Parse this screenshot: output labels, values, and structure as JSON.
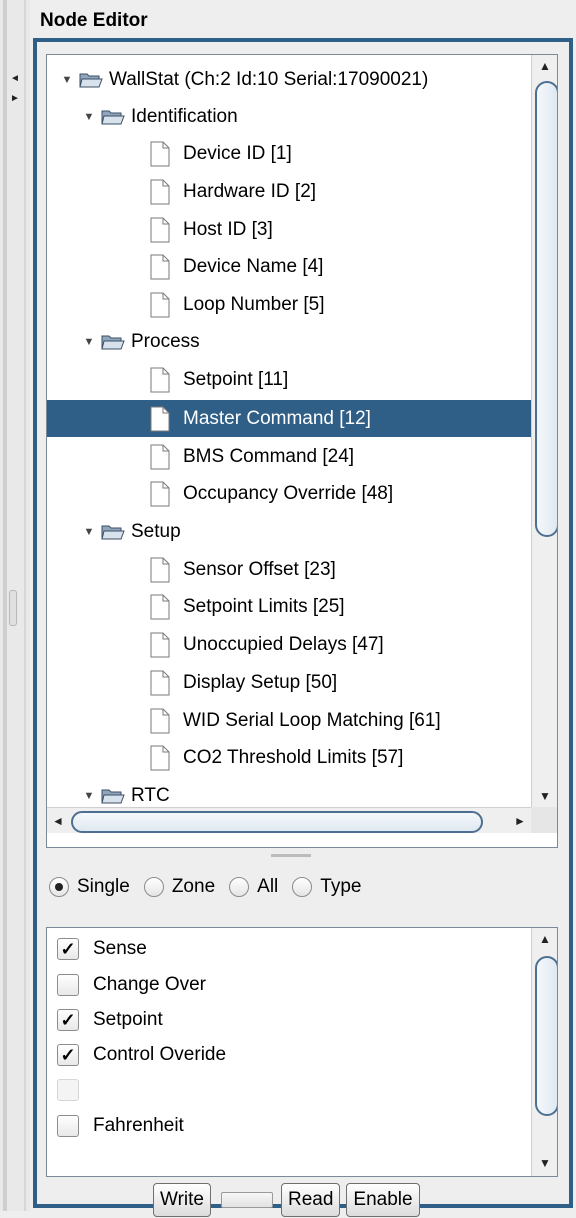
{
  "panel": {
    "title": "Node Editor"
  },
  "tree": {
    "items": [
      {
        "label": "WallStat (Ch:2 Id:10 Serial:17090021)",
        "type": "folder",
        "level": 0,
        "expanded": true,
        "selected": false
      },
      {
        "label": "Identification",
        "type": "folder",
        "level": 1,
        "expanded": true,
        "selected": false
      },
      {
        "label": "Device ID [1]",
        "type": "leaf",
        "level": 2,
        "selected": false
      },
      {
        "label": "Hardware ID [2]",
        "type": "leaf",
        "level": 2,
        "selected": false
      },
      {
        "label": "Host ID [3]",
        "type": "leaf",
        "level": 2,
        "selected": false
      },
      {
        "label": "Device Name [4]",
        "type": "leaf",
        "level": 2,
        "selected": false
      },
      {
        "label": "Loop Number [5]",
        "type": "leaf",
        "level": 2,
        "selected": false
      },
      {
        "label": "Process",
        "type": "folder",
        "level": 1,
        "expanded": true,
        "selected": false
      },
      {
        "label": "Setpoint [11]",
        "type": "leaf",
        "level": 2,
        "selected": false
      },
      {
        "label": "Master Command [12]",
        "type": "leaf",
        "level": 2,
        "selected": true
      },
      {
        "label": "BMS Command [24]",
        "type": "leaf",
        "level": 2,
        "selected": false
      },
      {
        "label": "Occupancy Override [48]",
        "type": "leaf",
        "level": 2,
        "selected": false
      },
      {
        "label": "Setup",
        "type": "folder",
        "level": 1,
        "expanded": true,
        "selected": false
      },
      {
        "label": "Sensor Offset [23]",
        "type": "leaf",
        "level": 2,
        "selected": false
      },
      {
        "label": "Setpoint Limits [25]",
        "type": "leaf",
        "level": 2,
        "selected": false
      },
      {
        "label": "Unoccupied Delays [47]",
        "type": "leaf",
        "level": 2,
        "selected": false
      },
      {
        "label": "Display Setup [50]",
        "type": "leaf",
        "level": 2,
        "selected": false
      },
      {
        "label": "WID Serial Loop Matching [61]",
        "type": "leaf",
        "level": 2,
        "selected": false
      },
      {
        "label": "CO2 Threshold Limits [57]",
        "type": "leaf",
        "level": 2,
        "selected": false
      },
      {
        "label": "RTC",
        "type": "folder",
        "level": 1,
        "expanded": true,
        "selected": false
      }
    ]
  },
  "mode": {
    "options": [
      {
        "label": "Single",
        "selected": true
      },
      {
        "label": "Zone",
        "selected": false
      },
      {
        "label": "All",
        "selected": false
      },
      {
        "label": "Type",
        "selected": false
      }
    ]
  },
  "options_list": [
    {
      "label": "Sense",
      "checked": true,
      "enabled": true
    },
    {
      "label": "Change Over",
      "checked": false,
      "enabled": true
    },
    {
      "label": "Setpoint",
      "checked": true,
      "enabled": true
    },
    {
      "label": "Control Overide",
      "checked": true,
      "enabled": true
    },
    {
      "label": "",
      "checked": false,
      "enabled": false
    },
    {
      "label": "Fahrenheit",
      "checked": false,
      "enabled": true
    }
  ],
  "buttons": {
    "write": "Write",
    "read": "Read",
    "enable": "Enable"
  },
  "progress": {
    "value": 0
  },
  "colors": {
    "accent": "#2f5e86",
    "selection": "#2f5e86"
  },
  "icons": {
    "tree_expanded": "triangle-down-icon",
    "folder": "folder-open-icon",
    "leaf": "document-icon",
    "checkmark": "✓",
    "scroll_up": "▲",
    "scroll_down": "▼",
    "scroll_left": "◄",
    "scroll_right": "►"
  }
}
